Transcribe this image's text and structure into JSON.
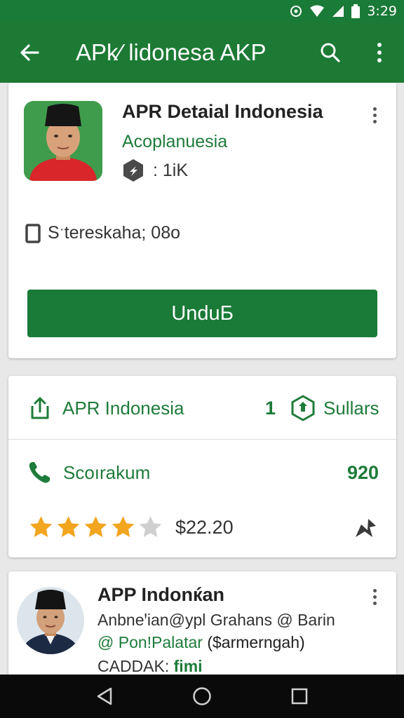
{
  "status_bar": {
    "time": "3:29"
  },
  "app_bar": {
    "title": "APk⁄ lidonesa AKP",
    "back_icon": "arrow-back-icon",
    "search_icon": "search-icon",
    "menu_icon": "more-vert-icon"
  },
  "app_card": {
    "name": "APR Detaial Indonesia",
    "developer": "Acoplanuesia",
    "downloads": ": 1iK",
    "storage": "Sˑtereskaha; 08o",
    "install_label": "UnduƂ"
  },
  "info_card": {
    "row1": {
      "label": "APR Indonesia",
      "count": "1",
      "badge_label": "Sullars"
    },
    "row2": {
      "label": "Scoırakum",
      "value": "920"
    },
    "row3": {
      "rating": 4,
      "rating_max": 5,
      "price": "$22.20"
    }
  },
  "review_card": {
    "name": "APP Indonќan",
    "line1": "Anbneꞌian@ypl Grahans @ Barin",
    "line2_prefix": "@ Pon!Palatar",
    "line2_suffix": " ($armerngah)",
    "line3_prefix": "CADDAK: ",
    "line3_link": "fimi"
  },
  "colors": {
    "primary": "#1a7a37",
    "accent": "#1e7b3a",
    "star": "#f2a51e"
  }
}
